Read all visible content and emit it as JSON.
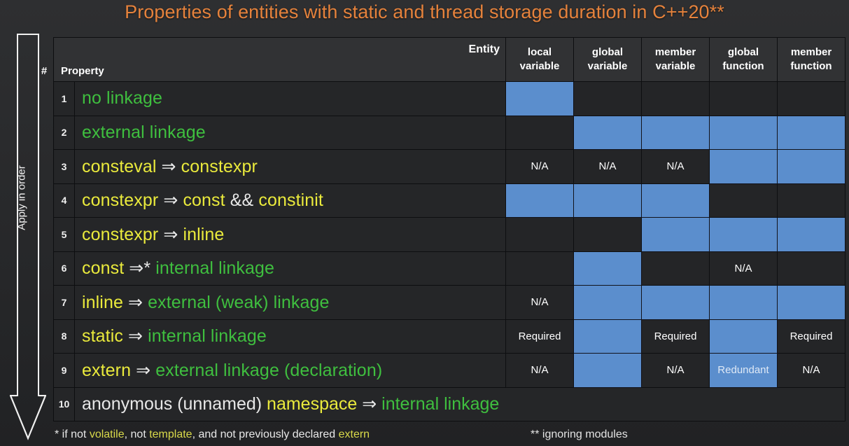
{
  "title": "Properties of entities with static and thread storage duration in C++20**",
  "side_arrow": {
    "label": "Apply in order",
    "icon": "arrow-down-icon"
  },
  "table": {
    "corner": {
      "entity_label": "Entity",
      "num_label": "#",
      "property_label": "Property"
    },
    "columns": [
      {
        "line1": "local",
        "line2": "variable"
      },
      {
        "line1": "global",
        "line2": "variable"
      },
      {
        "line1": "member",
        "line2": "variable"
      },
      {
        "line1": "global",
        "line2": "function"
      },
      {
        "line1": "member",
        "line2": "function"
      }
    ],
    "rows": [
      {
        "num": "1",
        "property_text": "no linkage",
        "property_tokens": [
          {
            "t": "no linkage",
            "c": "link"
          }
        ],
        "cells": [
          {
            "state": "on",
            "text": ""
          },
          {
            "state": "off",
            "text": ""
          },
          {
            "state": "off",
            "text": ""
          },
          {
            "state": "off",
            "text": ""
          },
          {
            "state": "off",
            "text": ""
          }
        ]
      },
      {
        "num": "2",
        "property_text": "external linkage",
        "property_tokens": [
          {
            "t": "external linkage",
            "c": "link"
          }
        ],
        "cells": [
          {
            "state": "off",
            "text": ""
          },
          {
            "state": "on",
            "text": ""
          },
          {
            "state": "on",
            "text": ""
          },
          {
            "state": "on",
            "text": ""
          },
          {
            "state": "on",
            "text": ""
          }
        ]
      },
      {
        "num": "3",
        "property_text": "consteval ⇒ constexpr",
        "property_tokens": [
          {
            "t": "consteval",
            "c": "kw"
          },
          {
            "t": " ⇒ ",
            "c": "plain"
          },
          {
            "t": "constexpr",
            "c": "kw"
          }
        ],
        "cells": [
          {
            "state": "off",
            "text": "N/A"
          },
          {
            "state": "off",
            "text": "N/A"
          },
          {
            "state": "off",
            "text": "N/A"
          },
          {
            "state": "on",
            "text": ""
          },
          {
            "state": "on",
            "text": ""
          }
        ]
      },
      {
        "num": "4",
        "property_text": "constexpr ⇒ const && constinit",
        "property_tokens": [
          {
            "t": "constexpr",
            "c": "kw"
          },
          {
            "t": " ⇒ ",
            "c": "plain"
          },
          {
            "t": "const",
            "c": "kw"
          },
          {
            "t": " && ",
            "c": "plain"
          },
          {
            "t": "constinit",
            "c": "kw"
          }
        ],
        "cells": [
          {
            "state": "on",
            "text": ""
          },
          {
            "state": "on",
            "text": ""
          },
          {
            "state": "on",
            "text": ""
          },
          {
            "state": "off",
            "text": ""
          },
          {
            "state": "off",
            "text": ""
          }
        ]
      },
      {
        "num": "5",
        "property_text": "constexpr ⇒ inline",
        "property_tokens": [
          {
            "t": "constexpr",
            "c": "kw"
          },
          {
            "t": " ⇒ ",
            "c": "plain"
          },
          {
            "t": "inline",
            "c": "kw"
          }
        ],
        "cells": [
          {
            "state": "off",
            "text": ""
          },
          {
            "state": "off",
            "text": ""
          },
          {
            "state": "on",
            "text": ""
          },
          {
            "state": "on",
            "text": ""
          },
          {
            "state": "on",
            "text": ""
          }
        ]
      },
      {
        "num": "6",
        "property_text": "const ⇒* internal linkage",
        "property_tokens": [
          {
            "t": "const",
            "c": "kw"
          },
          {
            "t": " ⇒* ",
            "c": "plain"
          },
          {
            "t": "internal linkage",
            "c": "link"
          }
        ],
        "cells": [
          {
            "state": "off",
            "text": ""
          },
          {
            "state": "on",
            "text": ""
          },
          {
            "state": "off",
            "text": ""
          },
          {
            "state": "off",
            "text": "N/A"
          },
          {
            "state": "off",
            "text": ""
          }
        ]
      },
      {
        "num": "7",
        "property_text": "inline ⇒ external (weak) linkage",
        "property_tokens": [
          {
            "t": "inline",
            "c": "kw"
          },
          {
            "t": " ⇒ ",
            "c": "plain"
          },
          {
            "t": "external (weak) linkage",
            "c": "link"
          }
        ],
        "cells": [
          {
            "state": "off",
            "text": "N/A"
          },
          {
            "state": "on",
            "text": ""
          },
          {
            "state": "on",
            "text": ""
          },
          {
            "state": "on",
            "text": ""
          },
          {
            "state": "on",
            "text": ""
          }
        ]
      },
      {
        "num": "8",
        "property_text": "static ⇒ internal linkage",
        "property_tokens": [
          {
            "t": "static",
            "c": "kw"
          },
          {
            "t": " ⇒ ",
            "c": "plain"
          },
          {
            "t": "internal linkage",
            "c": "link"
          }
        ],
        "cells": [
          {
            "state": "off",
            "text": "Required"
          },
          {
            "state": "on",
            "text": ""
          },
          {
            "state": "off",
            "text": "Required"
          },
          {
            "state": "on",
            "text": ""
          },
          {
            "state": "off",
            "text": "Required"
          }
        ]
      },
      {
        "num": "9",
        "property_text": "extern ⇒ external linkage (declaration)",
        "property_tokens": [
          {
            "t": "extern",
            "c": "kw"
          },
          {
            "t": " ⇒ ",
            "c": "plain"
          },
          {
            "t": "external linkage (declaration)",
            "c": "link"
          }
        ],
        "cells": [
          {
            "state": "off",
            "text": "N/A"
          },
          {
            "state": "on",
            "text": ""
          },
          {
            "state": "off",
            "text": "N/A"
          },
          {
            "state": "on",
            "text": "Redundant"
          },
          {
            "state": "off",
            "text": "N/A"
          }
        ]
      },
      {
        "num": "10",
        "full_width": true,
        "property_text": "anonymous (unnamed) namespace ⇒ internal linkage",
        "property_tokens": [
          {
            "t": "anonymous (unnamed) ",
            "c": "plain"
          },
          {
            "t": "namespace",
            "c": "kw"
          },
          {
            "t": " ⇒ ",
            "c": "plain"
          },
          {
            "t": "internal linkage",
            "c": "link"
          }
        ],
        "cells": []
      }
    ]
  },
  "footnotes": {
    "left_tokens": [
      {
        "t": "* if not ",
        "c": "plain"
      },
      {
        "t": "volatile",
        "c": "fn-kw"
      },
      {
        "t": ", not ",
        "c": "plain"
      },
      {
        "t": "template",
        "c": "fn-kw"
      },
      {
        "t": ", and not previously declared ",
        "c": "plain"
      },
      {
        "t": "extern",
        "c": "fn-kw"
      }
    ],
    "left_text": "* if not volatile, not template, and not previously declared extern",
    "right_text": "** ignoring modules"
  },
  "colors": {
    "title": "#e5823c",
    "keyword": "#eaea3c",
    "linkage": "#3fbf3f",
    "cell_on": "#5b8ecd",
    "cell_off": "#242527",
    "background": "#2a2b2d"
  }
}
